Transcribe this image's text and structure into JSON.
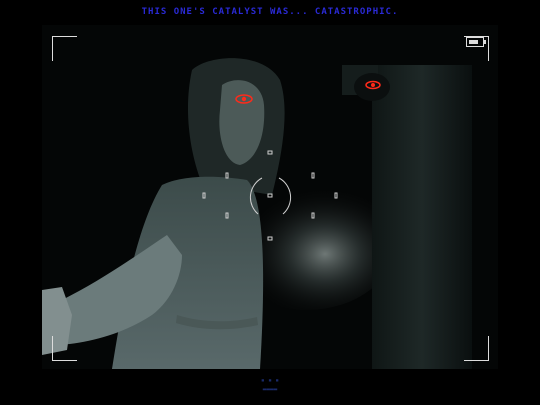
{
  "subtitle": {
    "text": "THIS ONE'S CATALYST WAS... CATASTROPHIC.",
    "color": "#2a2ad6"
  },
  "hud": {
    "frame_color": "#dddddd",
    "eye_color": "#ff2a1a",
    "bottom_indicator_top": "▪ ▪ ▪",
    "bottom_indicator_bottom": "▬▬▬▬"
  },
  "icons": [
    "battery-icon",
    "focus-reticle-icon"
  ]
}
